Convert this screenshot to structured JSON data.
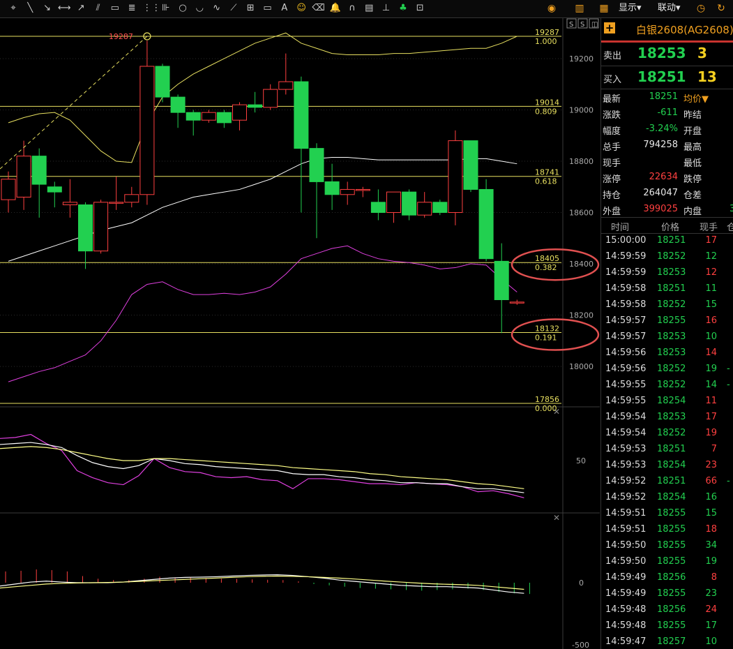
{
  "toolbar": {
    "tools": [
      "cursor-tool-icon",
      "line-tool-icon",
      "ray-tool-icon",
      "segment-tool-icon",
      "arrow-tool-icon",
      "parallel-lines-icon",
      "rectangle-tool-icon",
      "fibonacci-tool-icon",
      "gann-lines-icon",
      "ruler-tool-icon",
      "circle-tool-icon",
      "arc-tool-icon",
      "wave-tool-icon",
      "fan-tool-icon",
      "cycle-tool-icon",
      "price-label-icon",
      "text-tool-icon",
      "smiley-icon",
      "eraser-icon",
      "bell-icon",
      "magnet-icon",
      "list-icon",
      "calendar-icon",
      "clover-icon",
      "screenshot-icon"
    ],
    "text_tool_glyph": "A",
    "display_label": "显示",
    "link_label": "联动"
  },
  "chart_data": [
    {
      "type": "candlestick",
      "panel": "main",
      "ylim": [
        17856,
        19287
      ],
      "y_ticks": [
        19200,
        19000,
        18800,
        18600,
        18400,
        18200,
        18000
      ],
      "y_tick_labels": [
        "19200",
        "19000",
        "18800",
        "18600",
        "18400",
        "18200",
        "18000"
      ],
      "peak_marker": {
        "value": 19287,
        "label": "19287",
        "bar_index": 9
      },
      "candles": [
        {
          "open": 18650,
          "close": 18730,
          "high": 18760,
          "low": 18600
        },
        {
          "open": 18660,
          "close": 18820,
          "high": 18880,
          "low": 18610
        },
        {
          "open": 18820,
          "close": 18710,
          "high": 18850,
          "low": 18580
        },
        {
          "open": 18700,
          "close": 18680,
          "high": 18720,
          "low": 18620
        },
        {
          "open": 18630,
          "close": 18640,
          "high": 18730,
          "low": 18580
        },
        {
          "open": 18630,
          "close": 18450,
          "high": 18640,
          "low": 18380
        },
        {
          "open": 18450,
          "close": 18640,
          "high": 18650,
          "low": 18440
        },
        {
          "open": 18640,
          "close": 18640,
          "high": 18740,
          "low": 18610
        },
        {
          "open": 18640,
          "close": 18670,
          "high": 18700,
          "low": 18620
        },
        {
          "open": 18670,
          "close": 19170,
          "high": 19270,
          "low": 18630
        },
        {
          "open": 19170,
          "close": 19050,
          "high": 19180,
          "low": 19030
        },
        {
          "open": 19050,
          "close": 18990,
          "high": 19060,
          "low": 18930
        },
        {
          "open": 18990,
          "close": 18960,
          "high": 19000,
          "low": 18900
        },
        {
          "open": 18960,
          "close": 18990,
          "high": 19000,
          "low": 18950
        },
        {
          "open": 18990,
          "close": 18950,
          "high": 19000,
          "low": 18930
        },
        {
          "open": 18960,
          "close": 19020,
          "high": 19030,
          "low": 18920
        },
        {
          "open": 19020,
          "close": 19010,
          "high": 19070,
          "low": 18990
        },
        {
          "open": 19010,
          "close": 19080,
          "high": 19100,
          "low": 19000
        },
        {
          "open": 19080,
          "close": 19110,
          "high": 19220,
          "low": 19060
        },
        {
          "open": 19110,
          "close": 18850,
          "high": 19130,
          "low": 18600
        },
        {
          "open": 18850,
          "close": 18720,
          "high": 18870,
          "low": 18500
        },
        {
          "open": 18720,
          "close": 18670,
          "high": 18790,
          "low": 18610
        },
        {
          "open": 18670,
          "close": 18690,
          "high": 18720,
          "low": 18630
        },
        {
          "open": 18690,
          "close": 18690,
          "high": 18700,
          "low": 18660
        },
        {
          "open": 18640,
          "close": 18600,
          "high": 18690,
          "low": 18570
        },
        {
          "open": 18600,
          "close": 18680,
          "high": 18680,
          "low": 18560
        },
        {
          "open": 18680,
          "close": 18590,
          "high": 18690,
          "low": 18570
        },
        {
          "open": 18590,
          "close": 18640,
          "high": 18680,
          "low": 18580
        },
        {
          "open": 18640,
          "close": 18600,
          "high": 18650,
          "low": 18590
        },
        {
          "open": 18600,
          "close": 18880,
          "high": 18920,
          "low": 18550
        },
        {
          "open": 18880,
          "close": 18690,
          "high": 18880,
          "low": 18680
        },
        {
          "open": 18690,
          "close": 18420,
          "high": 18730,
          "low": 18410
        },
        {
          "open": 18410,
          "close": 18260,
          "high": 18480,
          "low": 18130
        },
        {
          "open": 18250,
          "close": 18251,
          "high": 18260,
          "low": 18240
        }
      ],
      "fibonacci_levels": [
        {
          "price_label": "19287",
          "ratio_label": "1.000",
          "price": 19287
        },
        {
          "price_label": "19014",
          "ratio_label": "0.809",
          "price": 19014
        },
        {
          "price_label": "18741",
          "ratio_label": "0.618",
          "price": 18741
        },
        {
          "price_label": "18405",
          "ratio_label": "0.382",
          "price": 18405
        },
        {
          "price_label": "18132",
          "ratio_label": "0.191",
          "price": 18132
        },
        {
          "price_label": "17856",
          "ratio_label": "0.000",
          "price": 17856
        }
      ],
      "highlighted_levels": [
        "18405",
        "18132"
      ],
      "bollinger": {
        "upper": [
          18950,
          18970,
          18985,
          18990,
          18960,
          18900,
          18840,
          18800,
          18795,
          18950,
          19050,
          19100,
          19140,
          19170,
          19200,
          19230,
          19260,
          19280,
          19300,
          19260,
          19240,
          19220,
          19215,
          19215,
          19215,
          19220,
          19220,
          19225,
          19230,
          19235,
          19240,
          19240,
          19260,
          19287
        ],
        "middle": [
          18410,
          18430,
          18450,
          18470,
          18490,
          18510,
          18530,
          18545,
          18560,
          18590,
          18620,
          18640,
          18660,
          18670,
          18680,
          18690,
          18710,
          18730,
          18760,
          18790,
          18810,
          18815,
          18815,
          18810,
          18805,
          18805,
          18805,
          18805,
          18805,
          18805,
          18810,
          18810,
          18800,
          18790
        ],
        "lower": [
          17940,
          17960,
          17980,
          17995,
          18020,
          18045,
          18100,
          18180,
          18280,
          18320,
          18330,
          18300,
          18280,
          18280,
          18285,
          18280,
          18290,
          18310,
          18360,
          18420,
          18440,
          18460,
          18470,
          18440,
          18420,
          18410,
          18405,
          18395,
          18380,
          18385,
          18400,
          18395,
          18340,
          18290
        ]
      },
      "trend_line": {
        "from_bar": 0,
        "from_price": 18810,
        "to_bar": 9,
        "to_price": 19287
      }
    },
    {
      "type": "line",
      "panel": "oscillator",
      "ylim": [
        0,
        100
      ],
      "y_ticks": [
        50
      ],
      "y_tick_labels": [
        "50"
      ],
      "series": [
        {
          "color": "#e040e0",
          "values": [
            72,
            73,
            76,
            67,
            60,
            40,
            33,
            28,
            26,
            35,
            52,
            43,
            39,
            38,
            34,
            33,
            34,
            31,
            30,
            22,
            32,
            32,
            31,
            29,
            27,
            27,
            26,
            28,
            27,
            26,
            24,
            19,
            20,
            17,
            13
          ]
        },
        {
          "color": "#ffffff",
          "values": [
            66,
            67,
            68,
            66,
            63,
            55,
            48,
            44,
            42,
            45,
            52,
            50,
            47,
            46,
            44,
            43,
            42,
            41,
            40,
            37,
            36,
            36,
            34,
            33,
            31,
            30,
            28,
            28,
            27,
            27,
            24,
            22,
            22,
            20,
            18
          ]
        },
        {
          "color": "#ffff88",
          "values": [
            62,
            63,
            64,
            63,
            61,
            58,
            55,
            52,
            50,
            50,
            52,
            52,
            51,
            50,
            49,
            48,
            47,
            46,
            45,
            43,
            42,
            41,
            40,
            39,
            37,
            36,
            34,
            33,
            32,
            31,
            29,
            27,
            26,
            24,
            22
          ]
        }
      ]
    },
    {
      "type": "bar",
      "panel": "macd",
      "ylim": [
        -500,
        500
      ],
      "y_ticks": [
        0,
        -500
      ],
      "y_tick_labels": [
        "0",
        "-500"
      ],
      "histogram": [
        85,
        90,
        100,
        95,
        85,
        50,
        30,
        20,
        20,
        30,
        45,
        40,
        38,
        35,
        30,
        28,
        25,
        22,
        20,
        10,
        -10,
        -20,
        -30,
        -40,
        -45,
        -50,
        -55,
        -60,
        -55,
        -50,
        -45,
        -55,
        -70,
        -80,
        -85
      ],
      "series": [
        {
          "color": "#ffffff",
          "values": [
            -25,
            -10,
            5,
            12,
            5,
            0,
            0,
            0,
            5,
            15,
            25,
            35,
            40,
            42,
            45,
            50,
            55,
            58,
            60,
            55,
            45,
            35,
            20,
            10,
            0,
            -10,
            -20,
            -25,
            -30,
            -30,
            -35,
            -40,
            -55,
            -70,
            -80
          ]
        },
        {
          "color": "#ffff88",
          "values": [
            -40,
            -30,
            -20,
            -10,
            -5,
            -2,
            0,
            2,
            5,
            10,
            15,
            20,
            25,
            30,
            35,
            40,
            45,
            48,
            50,
            48,
            45,
            40,
            35,
            28,
            20,
            12,
            5,
            -2,
            -8,
            -12,
            -15,
            -20,
            -30,
            -40,
            -50
          ]
        }
      ]
    }
  ],
  "quote": {
    "name": "白银2608(AG2608)",
    "sell_label": "卖出",
    "sell_price": "18253",
    "sell_vol": "3",
    "buy_label": "买入",
    "buy_price": "18251",
    "buy_vol": "13",
    "rows": [
      {
        "label": "最新",
        "value": "18251",
        "color": "#22d050",
        "label2": "均价▼"
      },
      {
        "label": "涨跌",
        "value": "-611",
        "color": "#22d050",
        "label2": "昨结"
      },
      {
        "label": "幅度",
        "value": "-3.24%",
        "color": "#22d050",
        "label2": "开盘"
      },
      {
        "label": "总手",
        "value": "794258",
        "color": "#e8e8e8",
        "label2": "最高"
      },
      {
        "label": "现手",
        "value": "",
        "color": "#e8e8e8",
        "label2": "最低"
      },
      {
        "label": "涨停",
        "value": "22634",
        "color": "#ff4040",
        "label2": "跌停"
      },
      {
        "label": "持仓",
        "value": "264047",
        "color": "#e8e8e8",
        "label2": "仓差"
      },
      {
        "label": "外盘",
        "value": "399025",
        "color": "#ff4040",
        "label2": "内盘",
        "value2": "3"
      }
    ],
    "tick_header": {
      "time": "时间",
      "price": "价格",
      "vol": "现手",
      "more": "仓"
    },
    "ticks": [
      {
        "time": "15:00:00",
        "price": "18251",
        "vol": "17",
        "vol_color": "#ff4040",
        "dir": ""
      },
      {
        "time": "14:59:59",
        "price": "18252",
        "vol": "12",
        "vol_color": "#22d050",
        "dir": ""
      },
      {
        "time": "14:59:59",
        "price": "18253",
        "vol": "12",
        "vol_color": "#ff4040",
        "dir": ""
      },
      {
        "time": "14:59:58",
        "price": "18251",
        "vol": "11",
        "vol_color": "#22d050",
        "dir": ""
      },
      {
        "time": "14:59:58",
        "price": "18252",
        "vol": "15",
        "vol_color": "#22d050",
        "dir": ""
      },
      {
        "time": "14:59:57",
        "price": "18255",
        "vol": "16",
        "vol_color": "#ff4040",
        "dir": ""
      },
      {
        "time": "14:59:57",
        "price": "18253",
        "vol": "10",
        "vol_color": "#22d050",
        "dir": ""
      },
      {
        "time": "14:59:56",
        "price": "18253",
        "vol": "14",
        "vol_color": "#ff4040",
        "dir": ""
      },
      {
        "time": "14:59:56",
        "price": "18252",
        "vol": "19",
        "vol_color": "#22d050",
        "dir": "-"
      },
      {
        "time": "14:59:55",
        "price": "18252",
        "vol": "14",
        "vol_color": "#22d050",
        "dir": "-"
      },
      {
        "time": "14:59:55",
        "price": "18254",
        "vol": "11",
        "vol_color": "#ff4040",
        "dir": ""
      },
      {
        "time": "14:59:54",
        "price": "18253",
        "vol": "17",
        "vol_color": "#ff4040",
        "dir": ""
      },
      {
        "time": "14:59:54",
        "price": "18252",
        "vol": "19",
        "vol_color": "#ff4040",
        "dir": ""
      },
      {
        "time": "14:59:53",
        "price": "18251",
        "vol": "7",
        "vol_color": "#ff4040",
        "dir": ""
      },
      {
        "time": "14:59:53",
        "price": "18254",
        "vol": "23",
        "vol_color": "#ff4040",
        "dir": ""
      },
      {
        "time": "14:59:52",
        "price": "18251",
        "vol": "66",
        "vol_color": "#ff4040",
        "dir": "-"
      },
      {
        "time": "14:59:52",
        "price": "18254",
        "vol": "16",
        "vol_color": "#22d050",
        "dir": ""
      },
      {
        "time": "14:59:51",
        "price": "18255",
        "vol": "15",
        "vol_color": "#22d050",
        "dir": ""
      },
      {
        "time": "14:59:51",
        "price": "18255",
        "vol": "18",
        "vol_color": "#ff4040",
        "dir": ""
      },
      {
        "time": "14:59:50",
        "price": "18255",
        "vol": "34",
        "vol_color": "#22d050",
        "dir": ""
      },
      {
        "time": "14:59:50",
        "price": "18255",
        "vol": "19",
        "vol_color": "#22d050",
        "dir": ""
      },
      {
        "time": "14:59:49",
        "price": "18256",
        "vol": "8",
        "vol_color": "#ff4040",
        "dir": ""
      },
      {
        "time": "14:59:49",
        "price": "18255",
        "vol": "23",
        "vol_color": "#22d050",
        "dir": ""
      },
      {
        "time": "14:59:48",
        "price": "18256",
        "vol": "24",
        "vol_color": "#ff4040",
        "dir": ""
      },
      {
        "time": "14:59:48",
        "price": "18255",
        "vol": "17",
        "vol_color": "#22d050",
        "dir": ""
      },
      {
        "time": "14:59:47",
        "price": "18257",
        "vol": "10",
        "vol_color": "#22d050",
        "dir": ""
      }
    ]
  },
  "panel_controls": {
    "settings_glyph": "S",
    "close_glyph": "✕"
  },
  "colors": {
    "up": "#ff4040",
    "down": "#22d050",
    "fib": "#e8e060",
    "highlight_circle": "#e05050",
    "price_green": "#22d050",
    "accent": "#f0a020"
  }
}
